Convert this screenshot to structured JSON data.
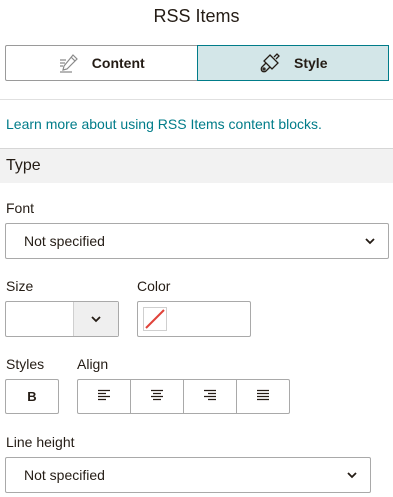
{
  "header": {
    "title": "RSS Items"
  },
  "tabs": [
    {
      "label": "Content",
      "icon": "pencil-icon",
      "active": false
    },
    {
      "label": "Style",
      "icon": "paint-brush-icon",
      "active": true
    }
  ],
  "help": {
    "link_text": "Learn more about using RSS Items content blocks."
  },
  "section": {
    "title": "Type"
  },
  "font": {
    "label": "Font",
    "value": "Not specified"
  },
  "size": {
    "label": "Size",
    "value": ""
  },
  "color": {
    "label": "Color",
    "value": "none"
  },
  "styles": {
    "label": "Styles",
    "bold_label": "B"
  },
  "align": {
    "label": "Align",
    "options": [
      "left",
      "center",
      "right",
      "justify"
    ]
  },
  "line_height": {
    "label": "Line height",
    "value": "Not specified"
  },
  "colors": {
    "accent": "#007c89",
    "active_tab_bg": "#d3e6e8",
    "swatch_slash": "#e0433a"
  }
}
